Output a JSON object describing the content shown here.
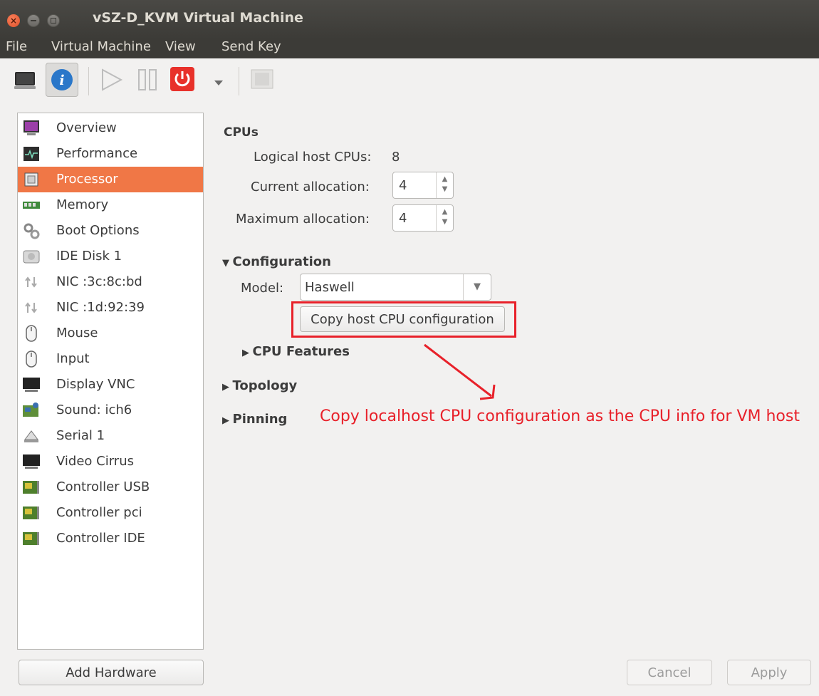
{
  "window": {
    "title": "vSZ-D_KVM Virtual Machine"
  },
  "menu": [
    "File",
    "Virtual Machine",
    "View",
    "Send Key"
  ],
  "toolbar": {
    "icons": [
      "monitor-icon",
      "info-icon",
      "play-icon",
      "pause-icon",
      "power-icon",
      "dropdown-arrow-icon",
      "fullscreen-icon"
    ]
  },
  "sidebar": {
    "items": [
      {
        "label": "Overview",
        "icon": "monitor-purple-icon"
      },
      {
        "label": "Performance",
        "icon": "performance-graph-icon"
      },
      {
        "label": "Processor",
        "icon": "chip-icon",
        "selected": true
      },
      {
        "label": "Memory",
        "icon": "memory-icon"
      },
      {
        "label": "Boot Options",
        "icon": "gears-icon"
      },
      {
        "label": "IDE Disk 1",
        "icon": "disk-icon"
      },
      {
        "label": "NIC :3c:8c:bd",
        "icon": "network-icon"
      },
      {
        "label": "NIC :1d:92:39",
        "icon": "network-icon"
      },
      {
        "label": "Mouse",
        "icon": "mouse-icon"
      },
      {
        "label": "Input",
        "icon": "mouse-icon"
      },
      {
        "label": "Display VNC",
        "icon": "display-icon"
      },
      {
        "label": "Sound: ich6",
        "icon": "sound-card-icon"
      },
      {
        "label": "Serial 1",
        "icon": "serial-icon"
      },
      {
        "label": "Video Cirrus",
        "icon": "display-icon"
      },
      {
        "label": "Controller USB",
        "icon": "controller-card-icon"
      },
      {
        "label": "Controller pci",
        "icon": "controller-card-icon"
      },
      {
        "label": "Controller IDE",
        "icon": "controller-card-icon"
      }
    ],
    "add_hardware": "Add Hardware"
  },
  "cpus": {
    "heading": "CPUs",
    "logical_label": "Logical host CPUs:",
    "logical_value": "8",
    "current_label": "Current allocation:",
    "current_value": "4",
    "max_label": "Maximum allocation:",
    "max_value": "4"
  },
  "configuration": {
    "heading": "Configuration",
    "model_label": "Model:",
    "model_value": "Haswell",
    "copy_button": "Copy host CPU configuration",
    "cpu_features": "CPU Features"
  },
  "topology": "Topology",
  "pinning": "Pinning",
  "annotation": "Copy localhost CPU configuration as the CPU info for VM host",
  "buttons": {
    "cancel": "Cancel",
    "apply": "Apply"
  },
  "colors": {
    "selection": "#f07746",
    "annotation": "#e8212a",
    "titlebar": "#3c3b37"
  }
}
